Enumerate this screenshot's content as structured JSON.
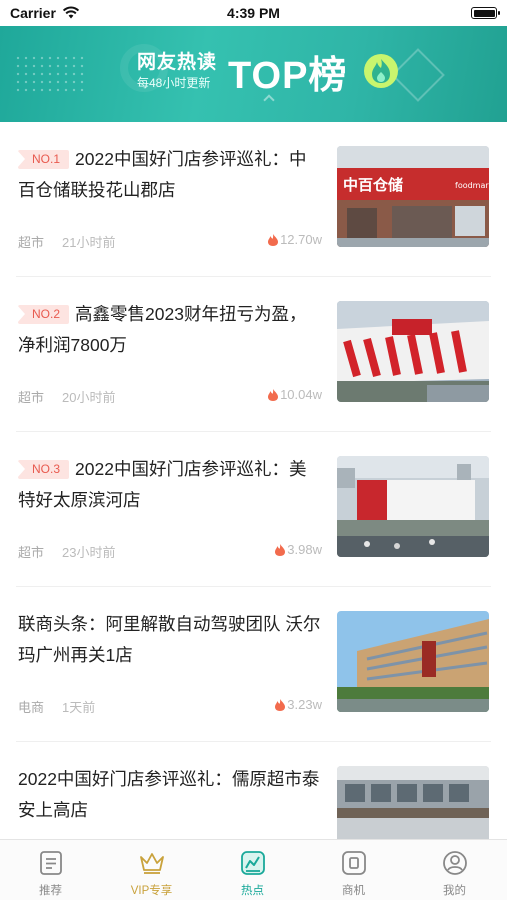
{
  "status_bar": {
    "carrier": "Carrier",
    "time": "4:39 PM"
  },
  "banner": {
    "title": "网友热读",
    "subtitle": "每48小时更新",
    "headline": "TOP榜"
  },
  "items": [
    {
      "rank": "NO.1",
      "title": "2022中国好门店参评巡礼：中百仓储联投花山郡店",
      "category": "超市",
      "time_ago": "21小时前",
      "heat": "12.70w"
    },
    {
      "rank": "NO.2",
      "title": "高鑫零售2023财年扭亏为盈，净利润7800万",
      "category": "超市",
      "time_ago": "20小时前",
      "heat": "10.04w"
    },
    {
      "rank": "NO.3",
      "title": "2022中国好门店参评巡礼：美特好太原滨河店",
      "category": "超市",
      "time_ago": "23小时前",
      "heat": "3.98w"
    },
    {
      "rank": "",
      "title": "联商头条：阿里解散自动驾驶团队 沃尔玛广州再关1店",
      "category": "电商",
      "time_ago": "1天前",
      "heat": "3.23w"
    },
    {
      "rank": "",
      "title": "2022中国好门店参评巡礼：儒原超市泰安上高店",
      "category": "",
      "time_ago": "",
      "heat": ""
    }
  ],
  "tabs": [
    {
      "label": "推荐",
      "icon": "document-icon"
    },
    {
      "label": "VIP专享",
      "icon": "crown-icon"
    },
    {
      "label": "热点",
      "icon": "trend-chart-icon"
    },
    {
      "label": "商机",
      "icon": "square-icon"
    },
    {
      "label": "我的",
      "icon": "user-icon"
    }
  ],
  "colors": {
    "accent": "#1aa99a",
    "rank_text": "#e85a4f",
    "rank_bg": "#fde4e1",
    "vip": "#c9a23c",
    "heat_icon": "#f26b4d"
  }
}
